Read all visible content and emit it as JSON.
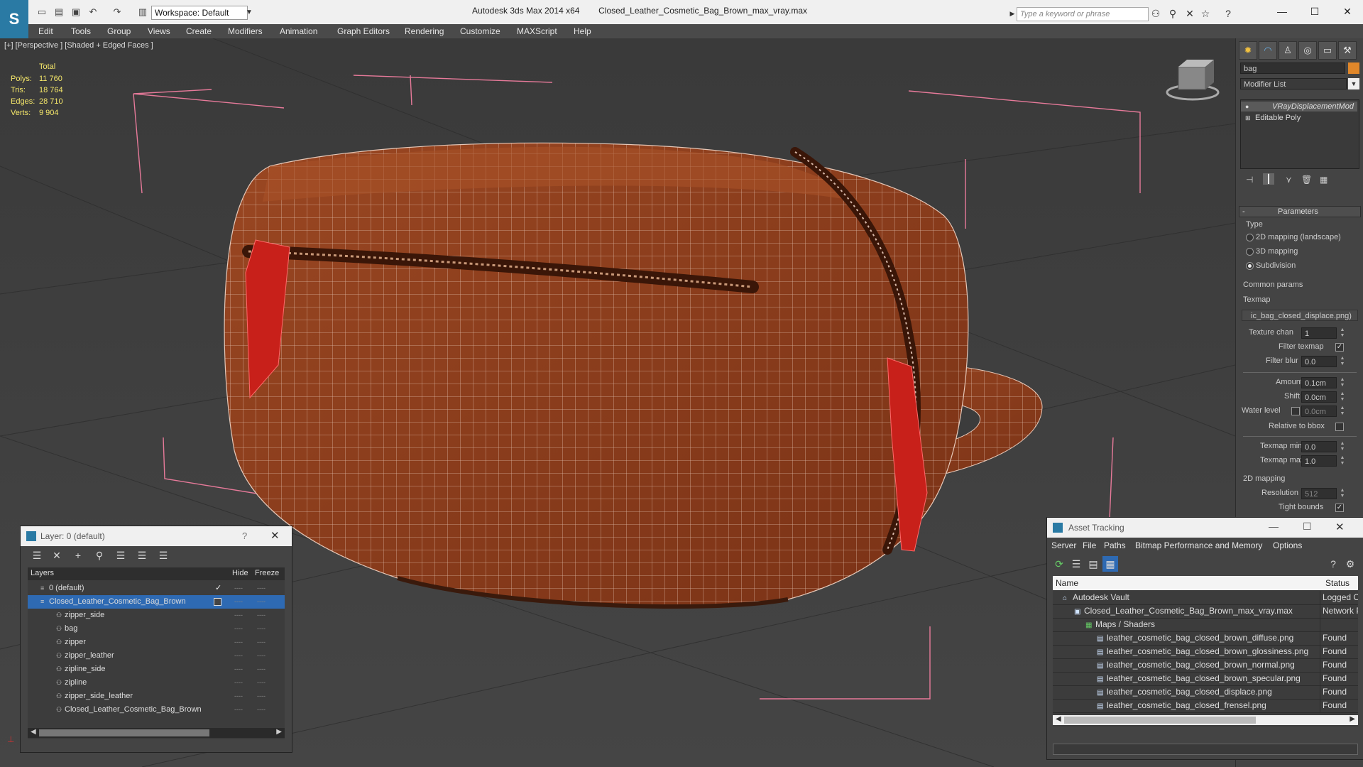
{
  "window": {
    "app_title": "Autodesk 3ds Max  2014 x64",
    "file_title": "Closed_Leather_Cosmetic_Bag_Brown_max_vray.max",
    "workspace": "Workspace: Default",
    "search_placeholder": "Type a keyword or phrase"
  },
  "menu": [
    "Edit",
    "Tools",
    "Group",
    "Views",
    "Create",
    "Modifiers",
    "Animation",
    "Graph Editors",
    "Rendering",
    "Customize",
    "MAXScript",
    "Help"
  ],
  "viewport": {
    "label": "[+] [Perspective ] [Shaded + Edged Faces ]",
    "stats_header": "Total",
    "stats": [
      {
        "label": "Polys:",
        "value": "11 760"
      },
      {
        "label": "Tris:",
        "value": "18 764"
      },
      {
        "label": "Edges:",
        "value": "28 710"
      },
      {
        "label": "Verts:",
        "value": "9 904"
      }
    ]
  },
  "command_panel": {
    "object_name": "bag",
    "modifier_list": "Modifier List",
    "stack": [
      "VRayDisplacementMod",
      "Editable Poly"
    ],
    "parameters_title": "Parameters",
    "type_label": "Type",
    "type_options": [
      "2D mapping (landscape)",
      "3D mapping",
      "Subdivision"
    ],
    "type_selected": 2,
    "common_params": "Common params",
    "texmap_label": "Texmap",
    "texmap_value": "ic_bag_closed_displace.png)",
    "texture_chan_label": "Texture chan",
    "texture_chan_value": "1",
    "filter_texmap_label": "Filter texmap",
    "filter_blur_label": "Filter blur",
    "filter_blur_value": "0.0",
    "amount_label": "Amount",
    "amount_value": "0.1cm",
    "shift_label": "Shift",
    "shift_value": "0.0cm",
    "water_level_label": "Water level",
    "water_level_value": "0.0cm",
    "relative_bbox_label": "Relative to bbox",
    "texmap_min_label": "Texmap min",
    "texmap_min_value": "0.0",
    "texmap_max_label": "Texmap max",
    "texmap_max_value": "1.0",
    "mapping_2d_label": "2D mapping",
    "resolution_label": "Resolution",
    "resolution_value": "512",
    "tight_bounds_label": "Tight bounds"
  },
  "layer_dialog": {
    "title": "Layer: 0 (default)",
    "help": "?",
    "columns": [
      "Layers",
      "Hide",
      "Freeze"
    ],
    "rows": [
      {
        "name": "0 (default)",
        "level": 0,
        "selected": false,
        "current": true
      },
      {
        "name": "Closed_Leather_Cosmetic_Bag_Brown",
        "level": 0,
        "selected": true,
        "current": false
      },
      {
        "name": "zipper_side",
        "level": 1,
        "selected": false,
        "current": false
      },
      {
        "name": "bag",
        "level": 1,
        "selected": false,
        "current": false
      },
      {
        "name": "zipper",
        "level": 1,
        "selected": false,
        "current": false
      },
      {
        "name": "zipper_leather",
        "level": 1,
        "selected": false,
        "current": false
      },
      {
        "name": "zipline_side",
        "level": 1,
        "selected": false,
        "current": false
      },
      {
        "name": "zipline",
        "level": 1,
        "selected": false,
        "current": false
      },
      {
        "name": "zipper_side_leather",
        "level": 1,
        "selected": false,
        "current": false
      },
      {
        "name": "Closed_Leather_Cosmetic_Bag_Brown",
        "level": 1,
        "selected": false,
        "current": false
      }
    ]
  },
  "asset_dialog": {
    "title": "Asset Tracking",
    "menu": [
      "Server",
      "File",
      "Paths",
      "Bitmap Performance and Memory",
      "Options"
    ],
    "columns": [
      "Name",
      "Status"
    ],
    "rows": [
      {
        "name": "Autodesk Vault",
        "level": 0,
        "status": "Logged O"
      },
      {
        "name": "Closed_Leather_Cosmetic_Bag_Brown_max_vray.max",
        "level": 1,
        "status": "Network P"
      },
      {
        "name": "Maps / Shaders",
        "level": 2,
        "status": ""
      },
      {
        "name": "leather_cosmetic_bag_closed_brown_diffuse.png",
        "level": 3,
        "status": "Found"
      },
      {
        "name": "leather_cosmetic_bag_closed_brown_glossiness.png",
        "level": 3,
        "status": "Found"
      },
      {
        "name": "leather_cosmetic_bag_closed_brown_normal.png",
        "level": 3,
        "status": "Found"
      },
      {
        "name": "leather_cosmetic_bag_closed_brown_specular.png",
        "level": 3,
        "status": "Found"
      },
      {
        "name": "leather_cosmetic_bag_closed_displace.png",
        "level": 3,
        "status": "Found"
      },
      {
        "name": "leather_cosmetic_bag_closed_frensel.png",
        "level": 3,
        "status": "Found"
      }
    ]
  },
  "colors": {
    "selection": "#2e6ab3",
    "stats_text": "#f5e76a",
    "bag_leather": "#8a3b1c",
    "zipper_pull": "#c8201a",
    "bbox_lines": "#e77a9a"
  }
}
